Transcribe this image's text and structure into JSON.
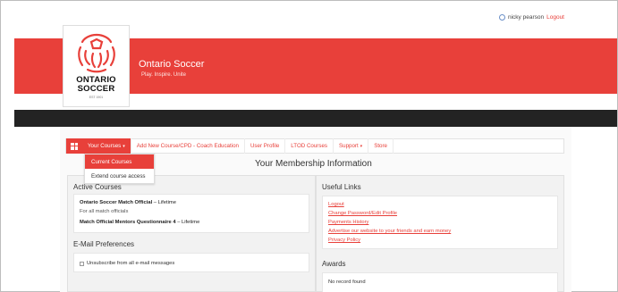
{
  "topbar": {
    "user_name": "nicky pearson",
    "logout_label": "Logout"
  },
  "brand": {
    "logo_line1": "ONTARIO",
    "logo_line2": "SOCCER",
    "logo_est": "EST 1901",
    "site_title": "Ontario Soccer",
    "tagline": "Play. Inspire. Unite",
    "accent_color": "#e8403a"
  },
  "nav": {
    "items": [
      {
        "label": "Your Courses",
        "caret": "▾"
      },
      {
        "label": "Add New Course/CPD - Coach Education"
      },
      {
        "label": "User Profile"
      },
      {
        "label": "LTOD Courses"
      },
      {
        "label": "Support",
        "caret": "▾"
      },
      {
        "label": "Store"
      }
    ]
  },
  "dropdown": {
    "items": [
      "Current Courses",
      "Extend course access"
    ]
  },
  "main": {
    "title": "Your Membership Information",
    "active_courses": {
      "heading": "Active Courses",
      "course1_name": "Ontario Soccer Match Official",
      "course1_term": " – Lifetime",
      "course1_sub": "For all match officials",
      "course2_name": "Match Official Mentors Questionnaire 4",
      "course2_term": " – Lifetime"
    },
    "email_prefs": {
      "heading": "E-Mail Preferences",
      "unsubscribe_label": "Unsubscribe from all e-mail messages"
    },
    "useful_links": {
      "heading": "Useful Links",
      "links": [
        "Logout",
        "Change Password/Edit Profile",
        "Payments History",
        "Advertise our website to your friends and earn money",
        "Privacy Policy"
      ]
    },
    "awards": {
      "heading": "Awards",
      "empty_text": "No record found"
    }
  }
}
